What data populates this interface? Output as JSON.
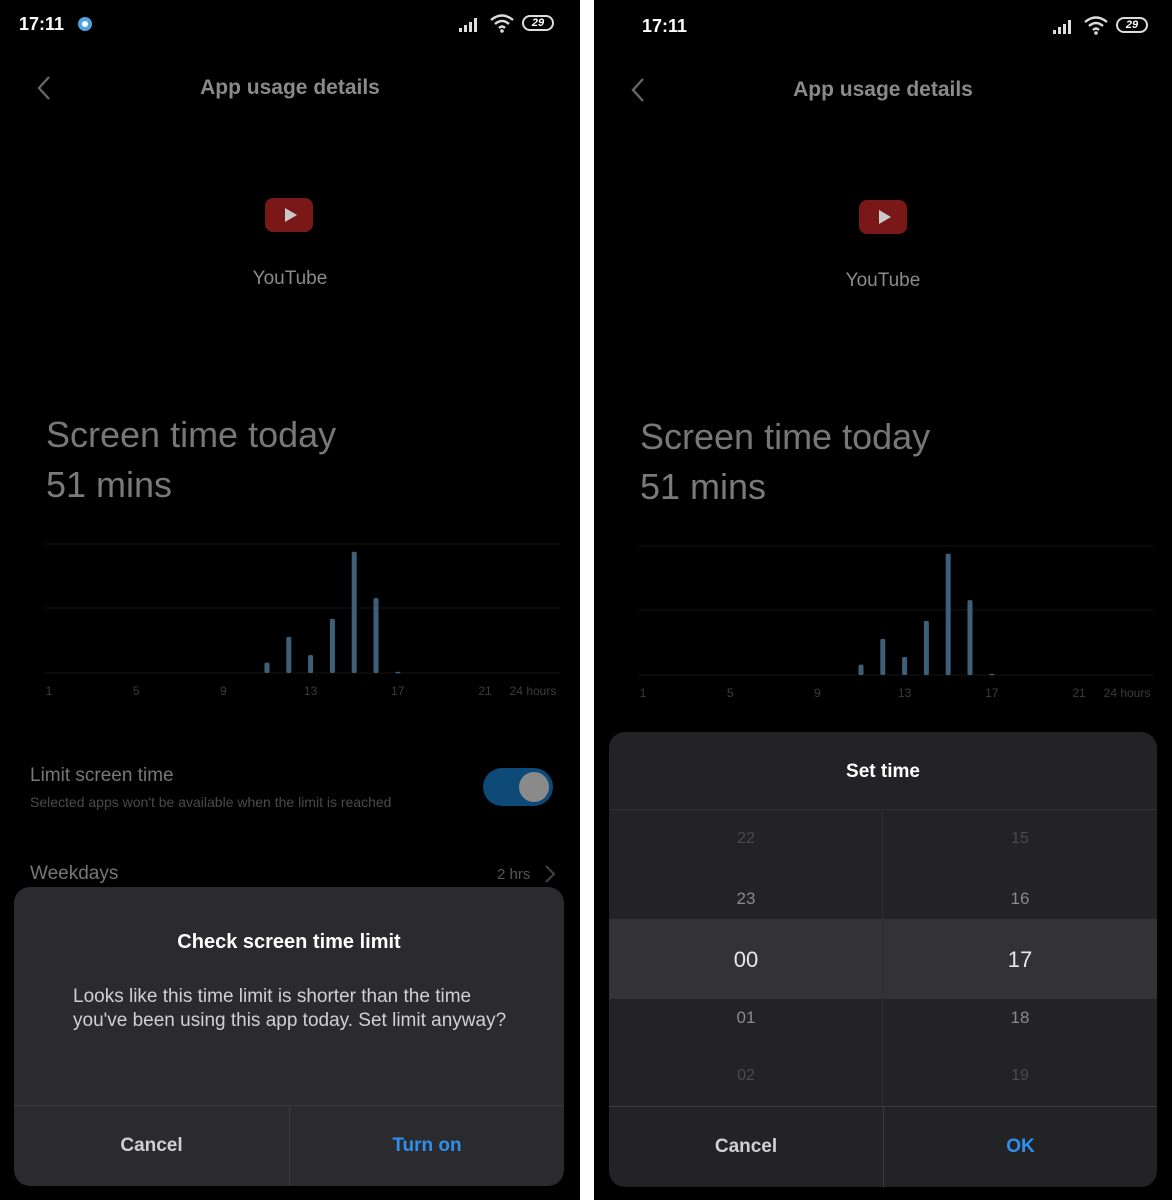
{
  "left_screen": {
    "status": {
      "time": "17:11",
      "battery": "29"
    },
    "header": {
      "title": "App usage details"
    },
    "app": {
      "name": "YouTube"
    },
    "screen_time": {
      "label": "Screen time today",
      "value": "51 mins"
    },
    "limit": {
      "title": "Limit screen time",
      "subtitle": "Selected apps won't be available when the limit is reached",
      "enabled": true
    },
    "weekdays": {
      "label": "Weekdays",
      "value": "2 hrs"
    },
    "dialog": {
      "title": "Check screen time limit",
      "message": "Looks like this time limit is shorter than the time you've been using this app today. Set limit anyway?",
      "cancel": "Cancel",
      "confirm": "Turn on"
    }
  },
  "right_screen": {
    "status": {
      "time": "17:11",
      "battery": "29"
    },
    "header": {
      "title": "App usage details"
    },
    "app": {
      "name": "YouTube"
    },
    "screen_time": {
      "label": "Screen time today",
      "value": "51 mins"
    },
    "dialog": {
      "title": "Set time",
      "hours": [
        "22",
        "23",
        "00",
        "01",
        "02"
      ],
      "minutes": [
        "15",
        "16",
        "17",
        "18",
        "19"
      ],
      "selected_hour": "00",
      "selected_minute": "17",
      "cancel": "Cancel",
      "confirm": "OK"
    }
  },
  "colors": {
    "background": "#000000",
    "bar": "#3f5f78",
    "accent": "#2d8ff0",
    "dialog": "#2b2b2d",
    "toggle_on": "#0e4a78"
  },
  "chart_data": {
    "type": "bar",
    "x_ticks": [
      "1",
      "5",
      "9",
      "13",
      "17",
      "21",
      "24 hours"
    ],
    "categories": [
      "11",
      "12",
      "13",
      "14",
      "15",
      "16",
      "17"
    ],
    "values": [
      4,
      14,
      7,
      21,
      47,
      29,
      0.5
    ],
    "ylim": [
      0,
      50
    ],
    "grid": true
  }
}
